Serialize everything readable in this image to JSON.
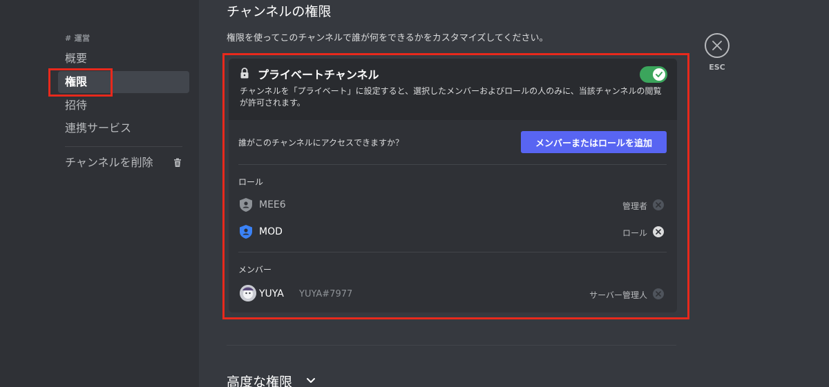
{
  "sidebar": {
    "category": "# 運営",
    "items": [
      {
        "label": "概要"
      },
      {
        "label": "権限"
      },
      {
        "label": "招待"
      },
      {
        "label": "連携サービス"
      }
    ],
    "delete_label": "チャンネルを削除",
    "highlight_color": "#e8291c"
  },
  "header": {
    "title": "チャンネルの権限",
    "description": "権限を使ってこのチャンネルで誰が何をできるかをカスタマイズしてください。"
  },
  "close": {
    "label": "ESC",
    "icon": "close-icon"
  },
  "private_channel": {
    "title": "プライベートチャンネル",
    "description": "チャンネルを「プライベート」に設定すると、選択したメンバーおよびロールの人のみに、当該チャンネルの閲覧が許可されます。",
    "enabled": true,
    "toggle_color": "#3ba55c"
  },
  "access": {
    "question": "誰がこのチャンネルにアクセスできますか？",
    "add_button": "メンバーまたはロールを追加",
    "button_color": "#5865f2"
  },
  "roles": {
    "label": "ロール",
    "items": [
      {
        "name": "MEE6",
        "role": "管理者"
      },
      {
        "name": "MOD",
        "role": "ロール"
      }
    ]
  },
  "members": {
    "label": "メンバー",
    "items": [
      {
        "name": "YUYA",
        "tag": "YUYA#7977",
        "role": "サーバー管理人"
      }
    ]
  },
  "advanced": {
    "label": "高度な権限"
  }
}
